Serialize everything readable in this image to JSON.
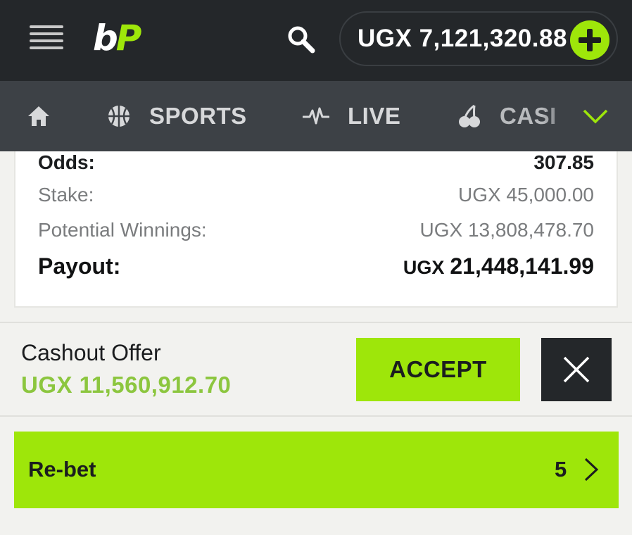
{
  "header": {
    "logo_b": "b",
    "logo_p": "P",
    "balance": "UGX 7,121,320.88",
    "icons": {
      "menu": "hamburger-icon",
      "search": "search-icon",
      "deposit": "plus-icon"
    },
    "accent_color": "#9ee60a"
  },
  "nav": {
    "items": [
      {
        "label": "",
        "icon": "home-icon"
      },
      {
        "label": "SPORTS",
        "icon": "basketball-icon"
      },
      {
        "label": "LIVE",
        "icon": "pulse-icon"
      },
      {
        "label": "CASI",
        "icon": "cherries-icon"
      }
    ],
    "more_icon": "chevron-down-icon"
  },
  "summary": {
    "odds_label": "Odds:",
    "odds_value": "307.85",
    "stake_label": "Stake:",
    "stake_value": "UGX 45,000.00",
    "winnings_label": "Potential Winnings:",
    "winnings_value": "UGX 13,808,478.70",
    "payout_label": "Payout:",
    "payout_currency": "UGX",
    "payout_value": "21,448,141.99"
  },
  "cashout": {
    "title": "Cashout Offer",
    "value": "UGX 11,560,912.70",
    "accept_label": "ACCEPT",
    "decline_icon": "close-icon"
  },
  "rebet": {
    "label": "Re-bet",
    "count": "5",
    "icon": "chevron-right-icon"
  }
}
